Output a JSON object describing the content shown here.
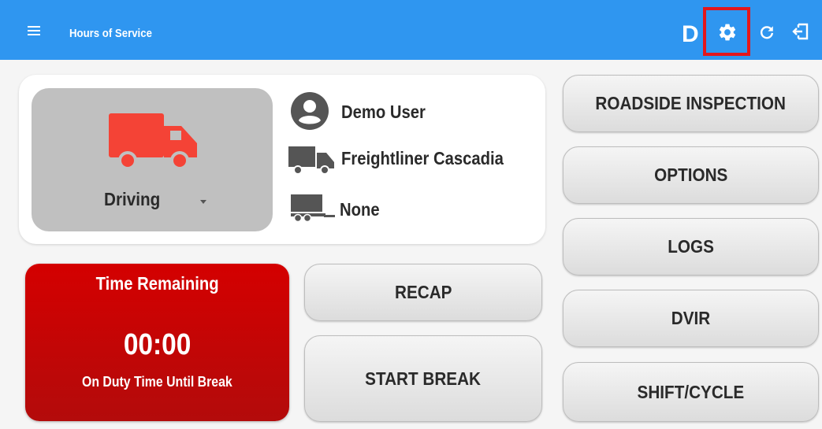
{
  "header": {
    "title": "Hours of Service",
    "status_letter": "D",
    "background_color": "#2f96f0",
    "icons": [
      "menu-icon",
      "gear-icon",
      "refresh-icon",
      "logout-icon"
    ]
  },
  "status_panel": {
    "duty_status": "Driving",
    "truck_color": "#f44336"
  },
  "driver_info": {
    "user": "Demo User",
    "vehicle": "Freightliner Cascadia",
    "trailer": "None"
  },
  "time_card": {
    "title": "Time Remaining",
    "value": "00:00",
    "subtitle": "On Duty Time Until Break",
    "color": "#cc0000"
  },
  "buttons": {
    "recap": "RECAP",
    "start_break": "START BREAK",
    "roadside_inspection": "ROADSIDE INSPECTION",
    "options": "OPTIONS",
    "logs": "LOGS",
    "dvir": "DVIR",
    "shift_cycle": "SHIFT/CYCLE"
  }
}
